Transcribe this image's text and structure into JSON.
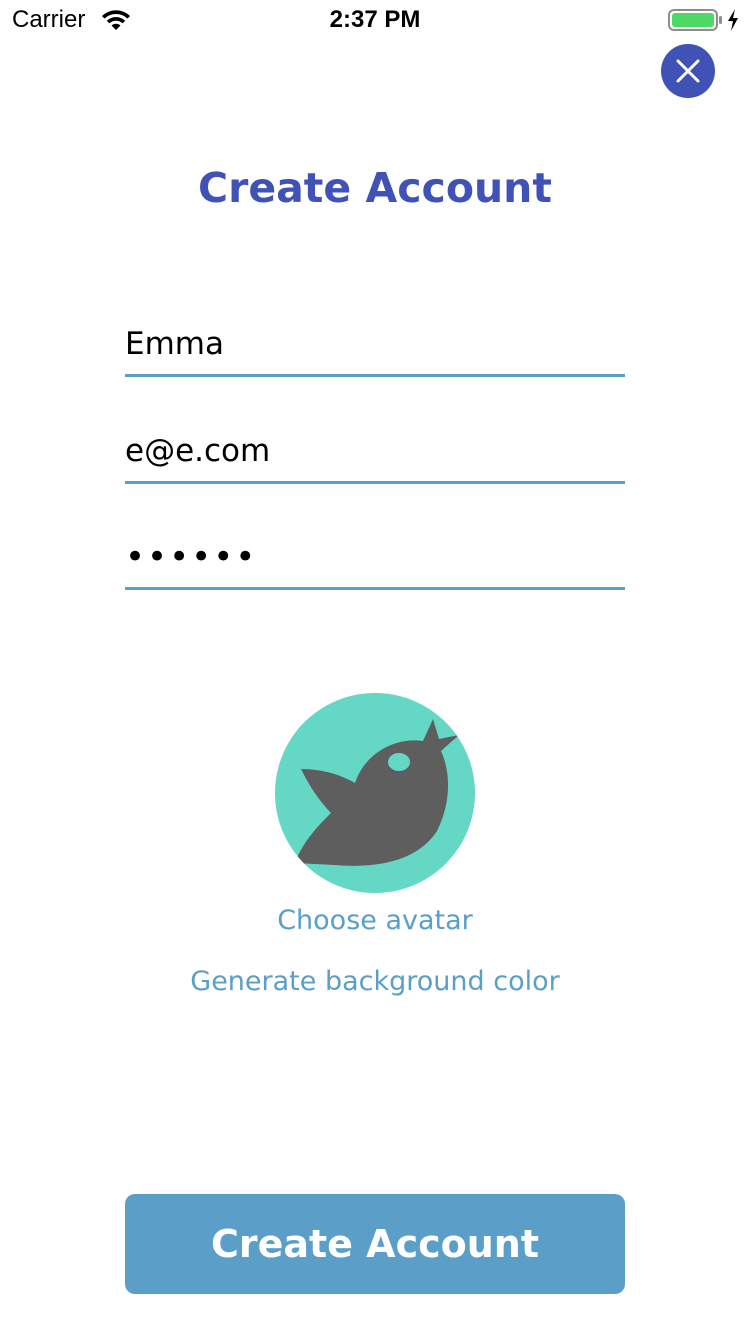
{
  "status_bar": {
    "carrier": "Carrier",
    "time": "2:37 PM",
    "battery_color": "#4cd964"
  },
  "header": {
    "title": "Create Account",
    "close_icon": "close-icon"
  },
  "form": {
    "username": {
      "value": "Emma"
    },
    "email": {
      "value": "e@e.com"
    },
    "password": {
      "value": "••••••"
    }
  },
  "avatar": {
    "icon": "bird-icon",
    "background_color": "#64d7c5",
    "choose_label": "Choose avatar",
    "generate_label": "Generate background color"
  },
  "actions": {
    "submit_label": "Create Account"
  },
  "colors": {
    "accent": "#4152b7",
    "link": "#5a9fc8",
    "button": "#5b9fc9"
  }
}
